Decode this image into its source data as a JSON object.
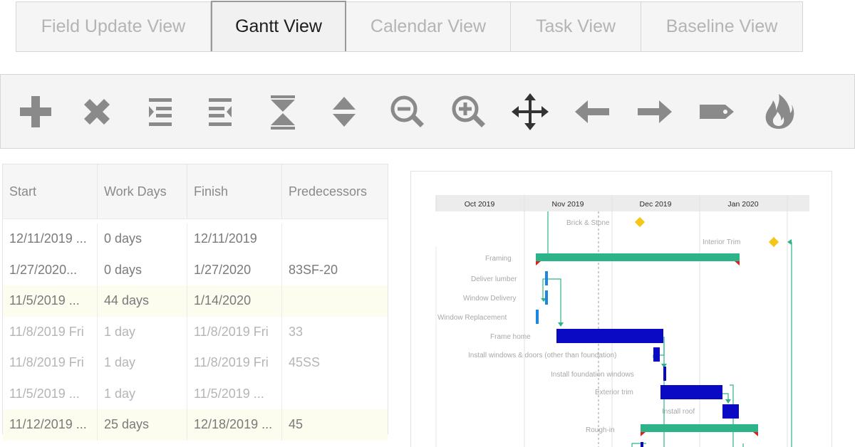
{
  "tabs": [
    {
      "label": "Field Update View",
      "active": false
    },
    {
      "label": "Gantt View",
      "active": true
    },
    {
      "label": "Calendar View",
      "active": false
    },
    {
      "label": "Task View",
      "active": false
    },
    {
      "label": "Baseline View",
      "active": false
    }
  ],
  "toolbar": {
    "icons": [
      "add-icon",
      "delete-icon",
      "indent-icon",
      "outdent-icon",
      "collapse-icon",
      "expand-icon",
      "zoom-out-icon",
      "zoom-in-icon",
      "move-icon",
      "arrow-left-icon",
      "arrow-right-icon",
      "tag-icon",
      "fire-icon"
    ],
    "icon_color": "#8a8a8a",
    "move_icon_color": "#333333"
  },
  "table": {
    "columns": [
      "Start",
      "Work Days",
      "Finish",
      "Predecessors"
    ],
    "rows": [
      {
        "start": "12/11/2019 ...",
        "work_days": "0 days",
        "finish": "12/11/2019",
        "predecessors": "",
        "style": "dark"
      },
      {
        "start": "1/27/2020...",
        "work_days": "0 days",
        "finish": "1/27/2020",
        "predecessors": "83SF-20",
        "style": "dark"
      },
      {
        "start": "11/5/2019 ...",
        "work_days": "44 days",
        "finish": "1/14/2020",
        "predecessors": "",
        "style": "dark-hl"
      },
      {
        "start": "11/8/2019 Fri",
        "work_days": "1 day",
        "finish": "11/8/2019 Fri",
        "predecessors": "33",
        "style": "light"
      },
      {
        "start": "11/8/2019 Fri",
        "work_days": "1 day",
        "finish": "11/8/2019 Fri",
        "predecessors": "45SS",
        "style": "light"
      },
      {
        "start": "11/5/2019 ...",
        "work_days": "1 day",
        "finish": "11/5/2019 ...",
        "predecessors": "",
        "style": "light"
      },
      {
        "start": "11/12/2019 ...",
        "work_days": "25 days",
        "finish": "12/18/2019 ...",
        "predecessors": "45",
        "style": "dark-hl"
      }
    ]
  },
  "gantt": {
    "months": [
      "Oct 2019",
      "Nov 2019",
      "Dec 2019",
      "Jan 2020"
    ],
    "tasks": [
      {
        "label": "Brick & Stone",
        "type": "milestone"
      },
      {
        "label": "Interior Trim",
        "type": "milestone"
      },
      {
        "label": "Framing",
        "type": "summary"
      },
      {
        "label": "Deliver lumber",
        "type": "task"
      },
      {
        "label": "Window Delivery",
        "type": "task"
      },
      {
        "label": "Window Replacement",
        "type": "task"
      },
      {
        "label": "Frame home",
        "type": "task"
      },
      {
        "label": "Install windows & doors (other than foundation)",
        "type": "task"
      },
      {
        "label": "Install foundation windows",
        "type": "task"
      },
      {
        "label": "Exterior trim",
        "type": "task"
      },
      {
        "label": "Install roof",
        "type": "task"
      },
      {
        "label": "Rough-in",
        "type": "summary"
      }
    ],
    "colors": {
      "summary": "#2db38a",
      "task": "#0a0ac4",
      "light_task": "#1c86e0",
      "milestone": "#f5c518",
      "summary_cap": "#e02020",
      "link": "#2db38a"
    }
  }
}
